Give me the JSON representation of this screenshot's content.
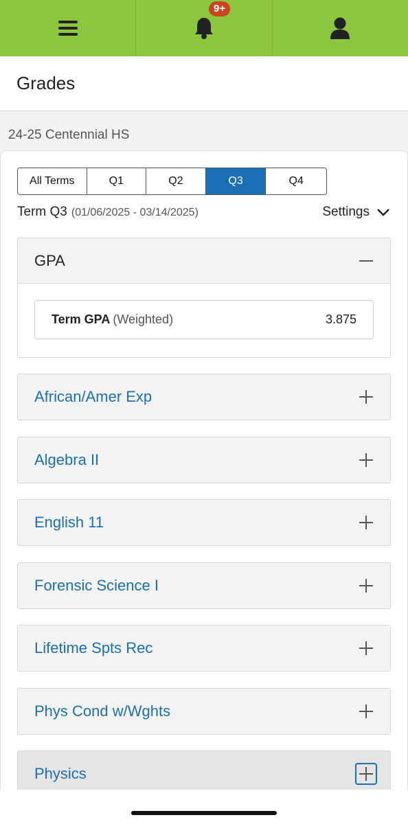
{
  "nav": {
    "menu_icon": "hamburger-menu-icon",
    "bell_icon": "bell-icon",
    "notification_badge": "9+",
    "user_icon": "user-icon",
    "brand_color": "#8cc63f"
  },
  "header": {
    "title": "Grades"
  },
  "school": "24-25 Centennial HS",
  "term_tabs": {
    "active_color": "#1a6fb5",
    "tabs": [
      "All Terms",
      "Q1",
      "Q2",
      "Q3",
      "Q4"
    ],
    "selected": "Q3"
  },
  "term_info": {
    "label": "Term Q3",
    "dates": "(01/06/2025 - 03/14/2025)",
    "settings_label": "Settings"
  },
  "gpa": {
    "title": "GPA",
    "label": "Term GPA",
    "sublabel": "(Weighted)",
    "value": "3.875"
  },
  "courses": [
    "African/Amer Exp",
    "Algebra II",
    "English 11",
    "Forensic Science I",
    "Lifetime Spts Rec",
    "Phys Cond w/Wghts",
    "Physics"
  ]
}
